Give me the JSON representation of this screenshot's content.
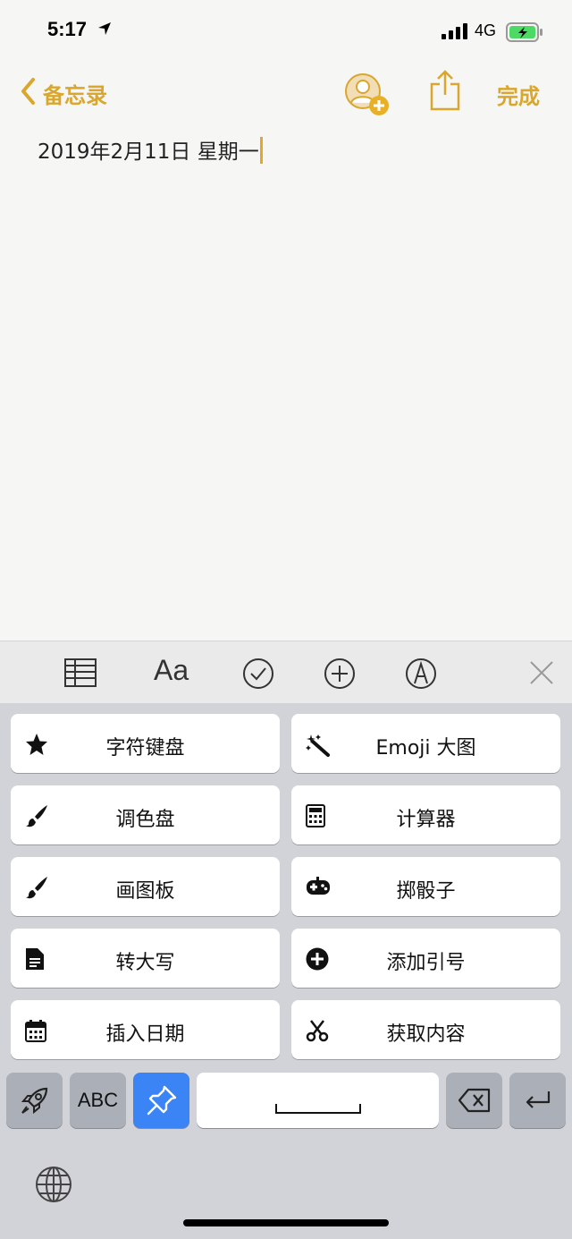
{
  "status_bar": {
    "time": "5:17",
    "network": "4G",
    "location_icon": "location-arrow-icon",
    "signal_icon": "signal-bars-icon",
    "battery_icon": "battery-charging-icon"
  },
  "nav": {
    "back_label": "备忘录",
    "done_label": "完成",
    "people_icon": "add-person-icon",
    "share_icon": "share-icon",
    "back_icon": "chevron-left-icon"
  },
  "note": {
    "text": "2019年2月11日 星期一"
  },
  "toolbar": {
    "font_label": "Aa",
    "items": [
      "table-icon",
      "font-icon",
      "checklist-icon",
      "plus-circle-icon",
      "markup-icon",
      "close-icon"
    ]
  },
  "keyboard": {
    "cards": [
      {
        "label": "字符键盘",
        "icon": "star-icon"
      },
      {
        "label": "Emoji 大图",
        "icon": "magic-wand-icon"
      },
      {
        "label": "调色盘",
        "icon": "brush-icon"
      },
      {
        "label": "计算器",
        "icon": "calculator-icon"
      },
      {
        "label": "画图板",
        "icon": "brush-icon"
      },
      {
        "label": "掷骰子",
        "icon": "gamepad-icon"
      },
      {
        "label": "转大写",
        "icon": "document-icon"
      },
      {
        "label": "添加引号",
        "icon": "plus-circle-icon"
      },
      {
        "label": "插入日期",
        "icon": "calendar-icon"
      },
      {
        "label": "获取内容",
        "icon": "scissors-icon"
      }
    ],
    "abc_label": "ABC",
    "bottom_keys": [
      "rocket-icon",
      "abc-key",
      "pin-icon",
      "space-key",
      "delete-icon",
      "return-icon"
    ],
    "globe_icon": "globe-icon"
  },
  "colors": {
    "accent": "#d9a62e",
    "keyboard_bg": "#d2d3d9",
    "blue_key": "#3a84f5"
  }
}
